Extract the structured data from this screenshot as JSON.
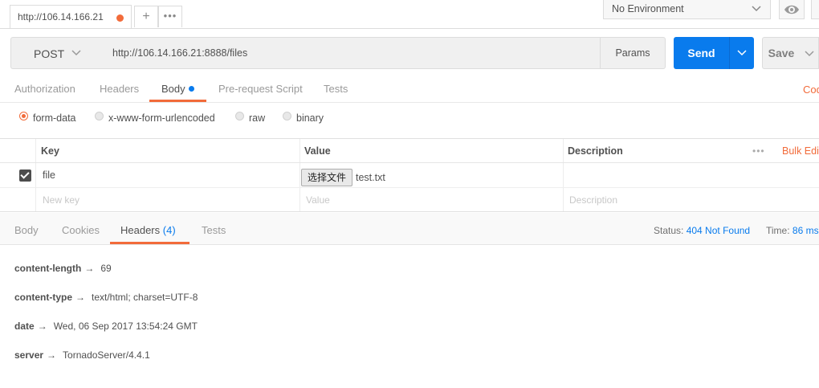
{
  "tab": {
    "title": "http://106.14.166.21",
    "add": "+",
    "more": "•••"
  },
  "environment": {
    "selected": "No Environment"
  },
  "request": {
    "method": "POST",
    "url": "http://106.14.166.21:8888/files",
    "params_label": "Params",
    "send_label": "Send",
    "save_label": "Save"
  },
  "request_tabs": [
    {
      "label": "Authorization"
    },
    {
      "label": "Headers"
    },
    {
      "label": "Body"
    },
    {
      "label": "Pre-request Script"
    },
    {
      "label": "Tests"
    }
  ],
  "code_link": "Code",
  "body_types": [
    {
      "label": "form-data",
      "selected": true
    },
    {
      "label": "x-www-form-urlencoded",
      "selected": false
    },
    {
      "label": "raw",
      "selected": false
    },
    {
      "label": "binary",
      "selected": false
    }
  ],
  "kv_table": {
    "headers": {
      "key": "Key",
      "value": "Value",
      "description": "Description",
      "more": "•••",
      "bulk_edit": "Bulk Edit"
    },
    "rows": [
      {
        "key": "file",
        "file_button": "选择文件",
        "file_name": "test.txt",
        "checked": true
      }
    ],
    "new_row": {
      "key_placeholder": "New key",
      "value_placeholder": "Value",
      "description_placeholder": "Description"
    }
  },
  "response_tabs": [
    {
      "label": "Body"
    },
    {
      "label": "Cookies"
    },
    {
      "label": "Headers",
      "count": "(4)"
    },
    {
      "label": "Tests"
    }
  ],
  "response_status": {
    "status_label": "Status:",
    "status_value": "404 Not Found",
    "time_label": "Time:",
    "time_value": "86 ms"
  },
  "response_headers": [
    {
      "key": "content-length",
      "arrow": "→",
      "value": "69"
    },
    {
      "key": "content-type",
      "arrow": "→",
      "value": "text/html; charset=UTF-8"
    },
    {
      "key": "date",
      "arrow": "→",
      "value": "Wed, 06 Sep 2017 13:54:24 GMT"
    },
    {
      "key": "server",
      "arrow": "→",
      "value": "TornadoServer/4.4.1"
    }
  ],
  "colors": {
    "accent": "#f26b3a",
    "primary": "#097bed",
    "text": "#505050",
    "muted": "#9a9a9a"
  },
  "icons": {
    "dropdown": "chevron-down-icon",
    "eye": "eye-icon",
    "checkbox": "checkbox-checked-icon",
    "unsaved": "unsaved-dot-icon"
  }
}
